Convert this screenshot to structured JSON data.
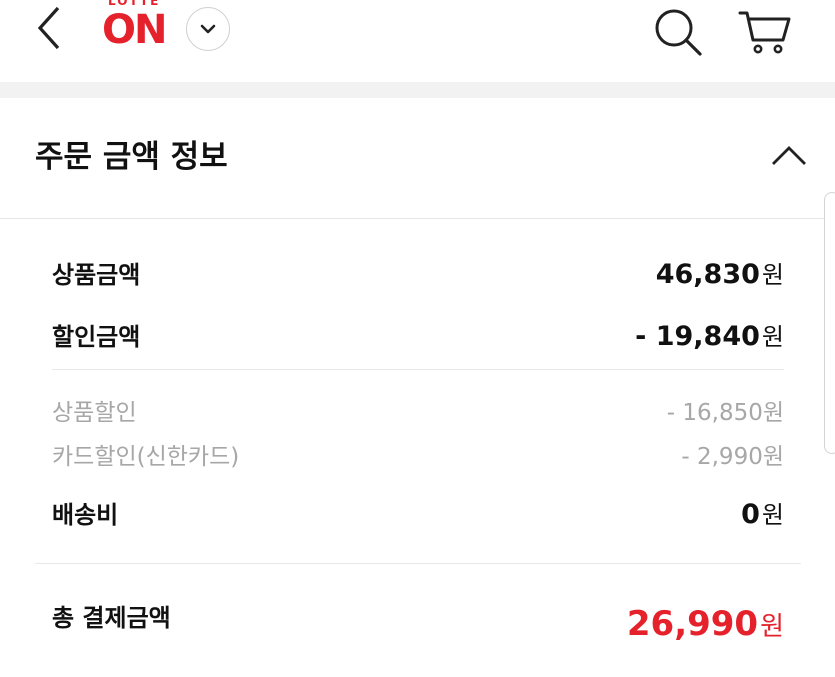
{
  "header": {
    "logo_small": "LOTTE",
    "logo_big": "ON",
    "icons": [
      "back-arrow-icon",
      "chevron-down-icon",
      "search-icon",
      "cart-icon"
    ]
  },
  "section": {
    "title": "주문 금액 정보",
    "collapse_icon": "chevron-up-icon"
  },
  "rows": {
    "product_amount": {
      "label": "상품금액",
      "value": "46,830",
      "unit": "원"
    },
    "discount_amount": {
      "label": "할인금액",
      "value": "- 19,840",
      "unit": "원"
    },
    "product_discount": {
      "label": "상품할인",
      "value": "- 16,850원"
    },
    "card_discount": {
      "label": "카드할인(신한카드)",
      "value": "- 2,990원"
    },
    "shipping": {
      "label": "배송비",
      "value": "0",
      "unit": "원"
    }
  },
  "total": {
    "label": "총 결제금액",
    "value": "26,990",
    "unit": "원"
  },
  "colors": {
    "brand_red": "#e5212c",
    "muted_text": "#a7a7a7",
    "band": "#f2f2f2"
  }
}
